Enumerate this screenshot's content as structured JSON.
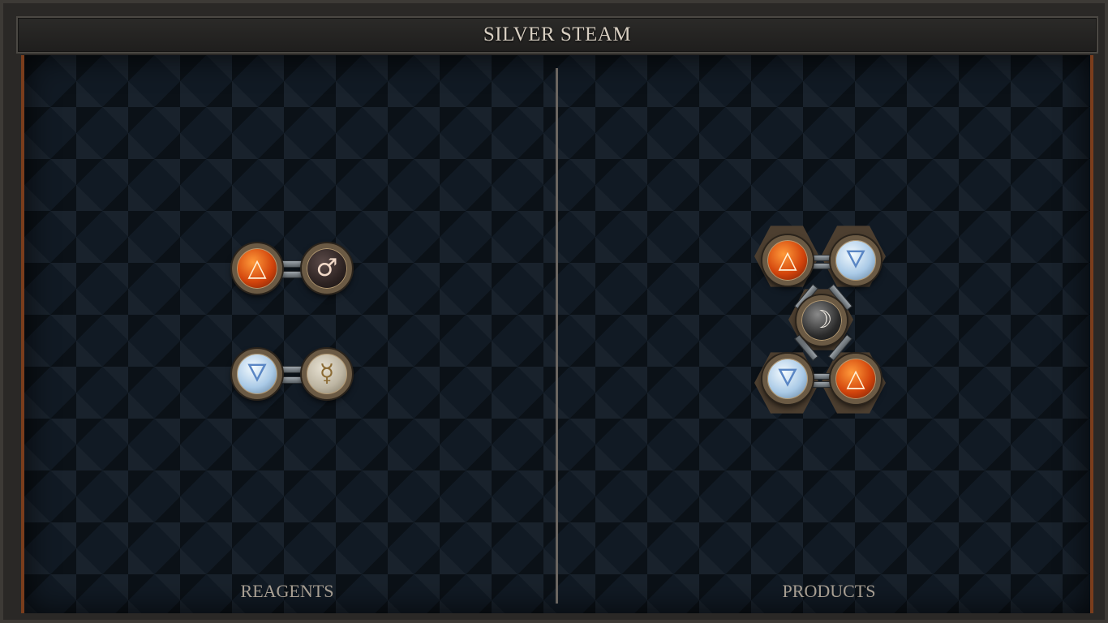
{
  "title": "SILVER STEAM",
  "panels": {
    "reagents_label": "REAGENTS",
    "products_label": "PRODUCTS"
  },
  "reagents": [
    {
      "atoms": [
        {
          "element": "fire",
          "glyph": "△"
        },
        {
          "element": "iron",
          "glyph": "♂"
        }
      ]
    },
    {
      "atoms": [
        {
          "element": "water",
          "glyph": "🜄"
        },
        {
          "element": "quicksilver",
          "glyph": "☿"
        }
      ]
    }
  ],
  "product": {
    "atoms": [
      {
        "element": "fire",
        "glyph": "△"
      },
      {
        "element": "water",
        "glyph": "🜄"
      },
      {
        "element": "silver",
        "glyph": "☽"
      },
      {
        "element": "water",
        "glyph": "🜄"
      },
      {
        "element": "fire",
        "glyph": "△"
      }
    ]
  },
  "colors": {
    "fire": "#d2440c",
    "water": "#a9c9e6",
    "iron": "#2c2221",
    "quicksilver": "#bdb5a2",
    "silver": "#2b2b2b",
    "board": "#111a24",
    "accent_border": "#7a3d1c"
  }
}
